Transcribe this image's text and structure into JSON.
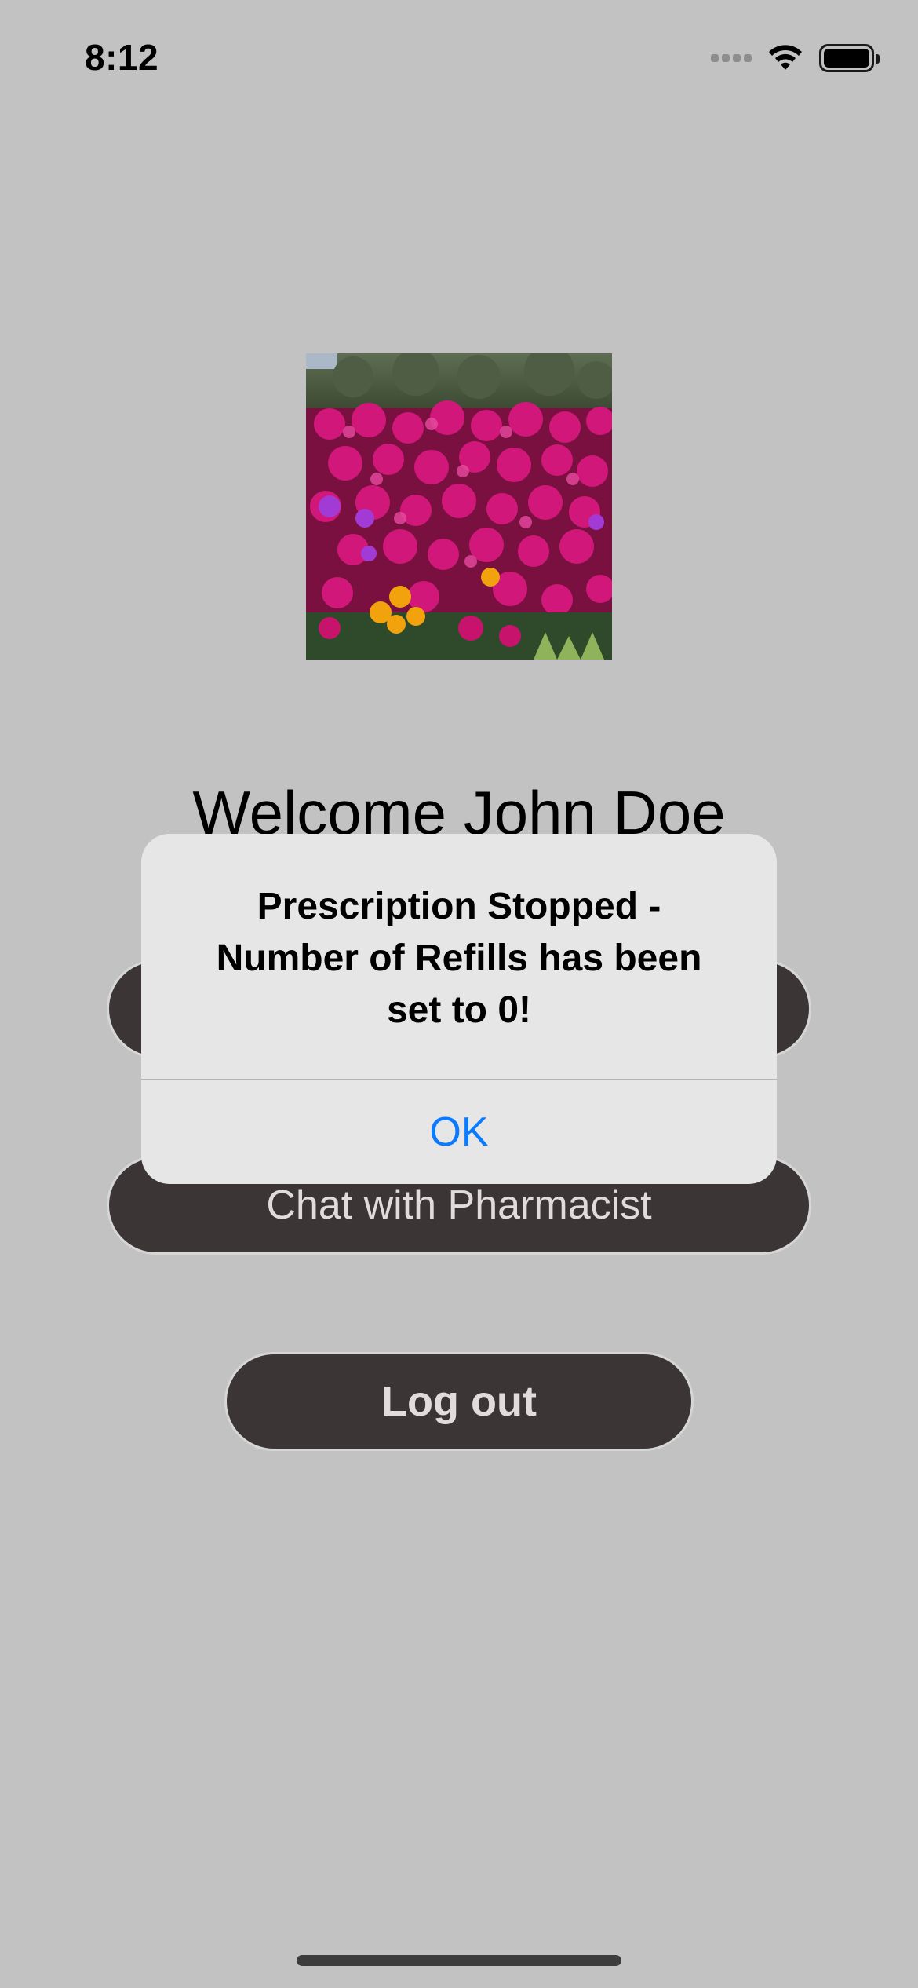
{
  "status_bar": {
    "time": "8:12",
    "icons": [
      "cellular-signal-icon",
      "wifi-icon",
      "battery-icon"
    ]
  },
  "profile": {
    "photo_subject": "flower-photo"
  },
  "welcome": {
    "text": "Welcome John Doe"
  },
  "buttons": {
    "chat_label": "Chat with Pharmacist",
    "logout_label": "Log out"
  },
  "alert": {
    "title": "Prescription Stopped - Number of Refills has been set to 0!",
    "ok_label": "OK"
  },
  "colors": {
    "background": "#c2c2c2",
    "button": "#3b3535",
    "button_text": "#e0dcdc",
    "alert_background": "#e6e6e6",
    "alert_action": "#0a7aff"
  }
}
